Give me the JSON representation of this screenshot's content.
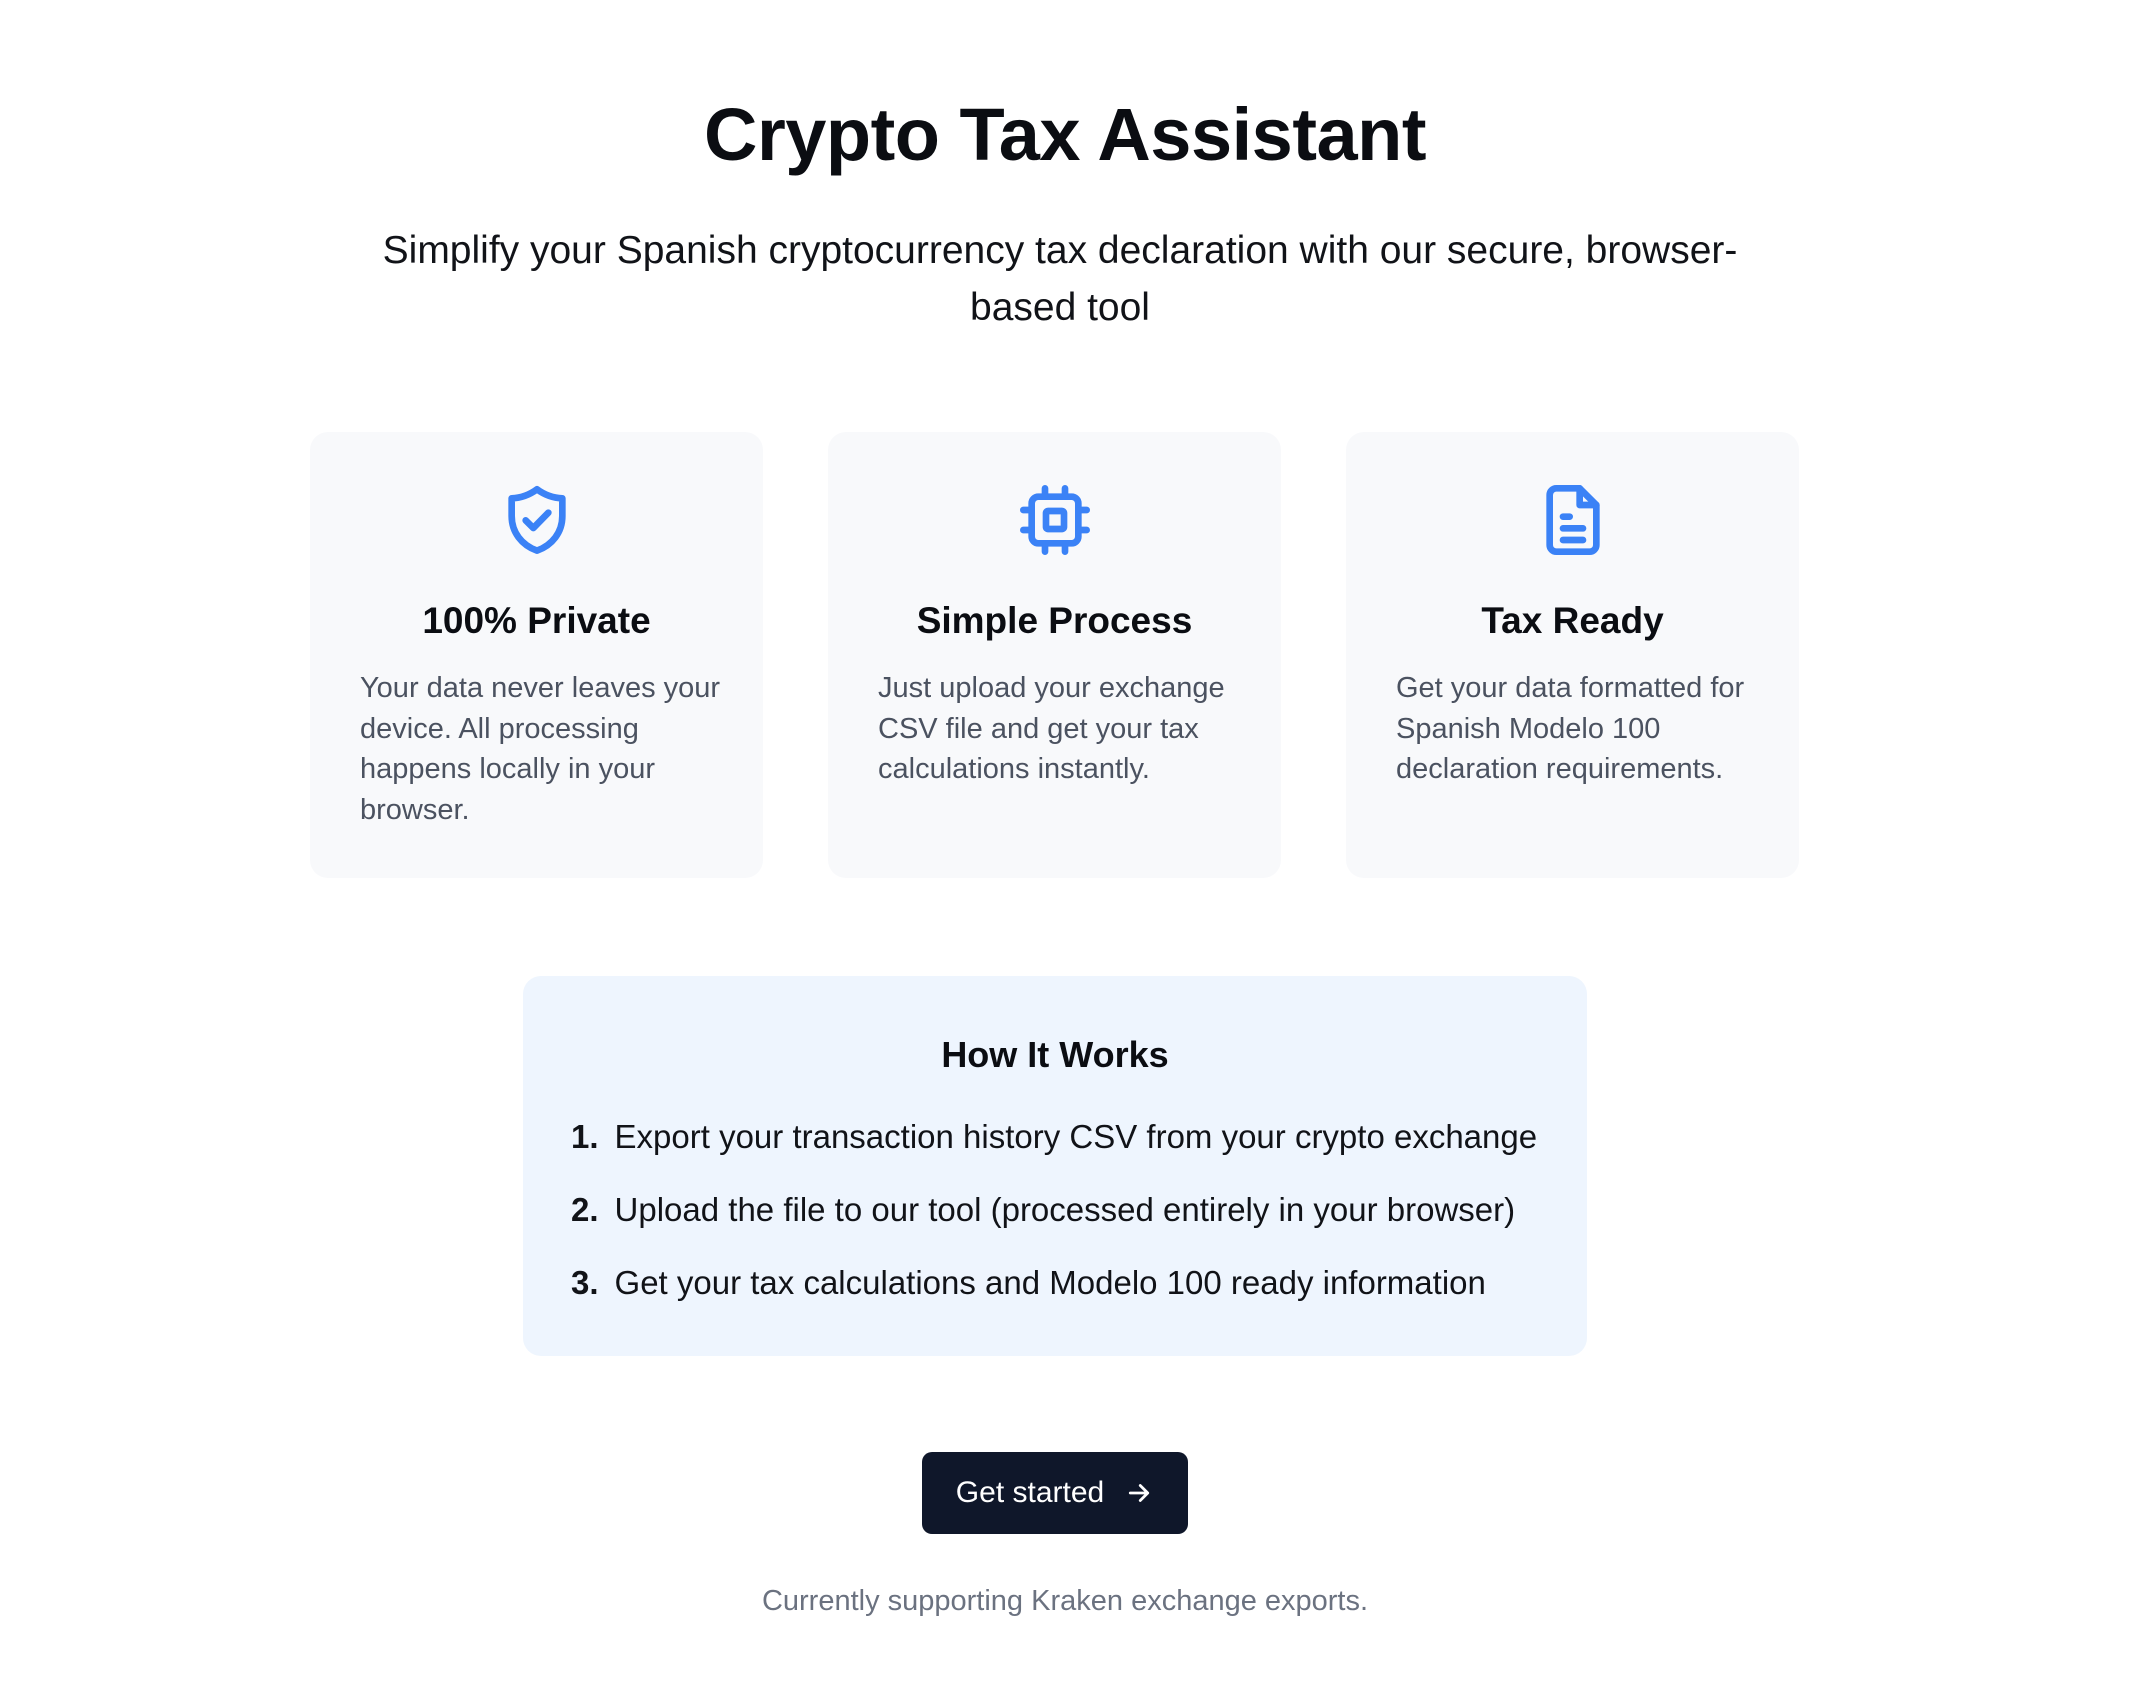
{
  "hero": {
    "title": "Crypto Tax Assistant",
    "subtitle": "Simplify your Spanish cryptocurrency tax declaration with our secure, browser-based tool"
  },
  "features": [
    {
      "icon": "shield-check-icon",
      "title": "100% Private",
      "text": "Your data never leaves your device. All processing happens locally in your browser."
    },
    {
      "icon": "cpu-chip-icon",
      "title": "Simple Process",
      "text": "Just upload your exchange CSV file and get your tax calculations instantly."
    },
    {
      "icon": "document-text-icon",
      "title": "Tax Ready",
      "text": "Get your data formatted for Spanish Modelo 100 declaration requirements."
    }
  ],
  "how_it_works": {
    "title": "How It Works",
    "steps": [
      {
        "number": "1.",
        "text": "Export your transaction history CSV from your crypto exchange"
      },
      {
        "number": "2.",
        "text": "Upload the file to our tool (processed entirely in your browser)"
      },
      {
        "number": "3.",
        "text": "Get your tax calculations and Modelo 100 ready information"
      }
    ]
  },
  "cta": {
    "label": "Get started",
    "icon": "arrow-right-icon"
  },
  "footnote": "Currently supporting Kraken exchange exports.",
  "colors": {
    "accent": "#3b82f6",
    "button_bg": "#0f172a",
    "card_bg": "#f8f9fb",
    "how_bg": "#eef5fe",
    "muted_text": "#4b5260"
  }
}
